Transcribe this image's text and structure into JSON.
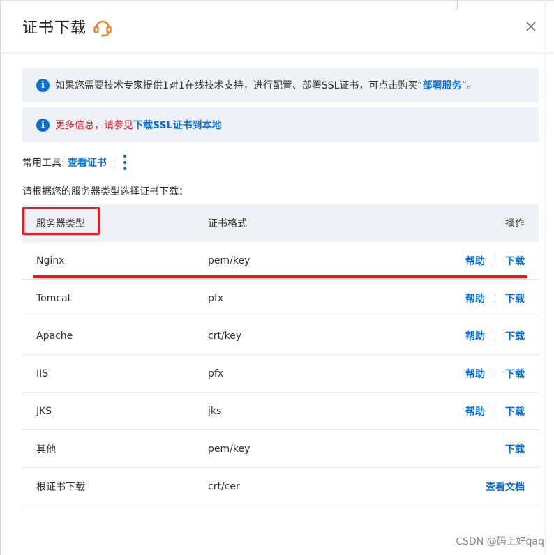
{
  "dialog": {
    "title": "证书下载",
    "close_icon": "close-icon",
    "support_icon": "headset-icon"
  },
  "notices": [
    {
      "prefix": "如果您需要技术专家提供1对1在线技术支持，进行配置、部署SSL证书，可点击购买“",
      "link": "部署服务",
      "suffix": "”。"
    },
    {
      "prefix": "更多信息，请参见",
      "link": "下载SSL证书到本地"
    }
  ],
  "tools": {
    "label": "常用工具:",
    "link": "查看证书"
  },
  "hint": "请根据您的服务器类型选择证书下载：",
  "table": {
    "headers": [
      "服务器类型",
      "证书格式",
      "操作"
    ],
    "rows": [
      {
        "server": "Nginx",
        "format": "pem/key",
        "help": "帮助",
        "download": "下载"
      },
      {
        "server": "Tomcat",
        "format": "pfx",
        "help": "帮助",
        "download": "下载"
      },
      {
        "server": "Apache",
        "format": "crt/key",
        "help": "帮助",
        "download": "下载"
      },
      {
        "server": "IIS",
        "format": "pfx",
        "help": "帮助",
        "download": "下载"
      },
      {
        "server": "JKS",
        "format": "jks",
        "help": "帮助",
        "download": "下载"
      },
      {
        "server": "其他",
        "format": "pem/key",
        "download": "下载"
      },
      {
        "server": "根证书下载",
        "format": "crt/cer",
        "docs": "查看文档"
      }
    ]
  },
  "watermark": "CSDN @码上好qaq",
  "colors": {
    "accent": "#0a6fd1",
    "annotation_red": "#e01b24",
    "notice_bg": "#eef2f6",
    "icon_orange": "#f5821f"
  }
}
